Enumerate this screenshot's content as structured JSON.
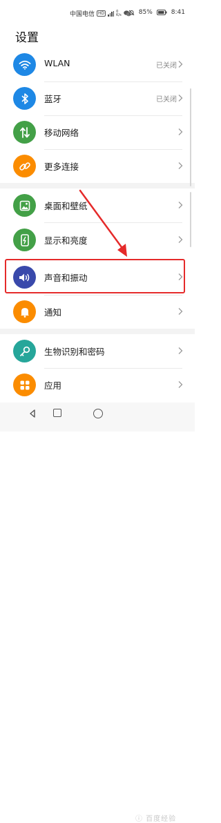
{
  "status_bar": {
    "carrier": "中国电信",
    "network_badge": "HD",
    "speed_value": "0",
    "speed_unit": "K/s",
    "battery": "85%",
    "time": "8:41"
  },
  "header": {
    "title": "设置"
  },
  "settings": [
    {
      "label": "WLAN",
      "status": "已关闭",
      "icon": "wifi-icon",
      "color": "#1e88e5"
    },
    {
      "label": "蓝牙",
      "status": "已关闭",
      "icon": "bluetooth-icon",
      "color": "#1e88e5"
    },
    {
      "label": "移动网络",
      "status": "",
      "icon": "mobile-data-icon",
      "color": "#43a047"
    },
    {
      "label": "更多连接",
      "status": "",
      "icon": "link-icon",
      "color": "#fb8c00"
    },
    {
      "label": "桌面和壁纸",
      "status": "",
      "icon": "wallpaper-icon",
      "color": "#43a047"
    },
    {
      "label": "显示和亮度",
      "status": "",
      "icon": "brightness-icon",
      "color": "#43a047"
    },
    {
      "label": "声音和振动",
      "status": "",
      "icon": "sound-icon",
      "color": "#3949ab"
    },
    {
      "label": "通知",
      "status": "",
      "icon": "notification-bell-icon",
      "color": "#fb8c00"
    },
    {
      "label": "生物识别和密码",
      "status": "",
      "icon": "key-icon",
      "color": "#26a69a"
    },
    {
      "label": "应用",
      "status": "",
      "icon": "apps-grid-icon",
      "color": "#fb8c00"
    }
  ],
  "annotation": {
    "highlight_color": "#e52a2a",
    "highlighted_item": "声音和振动"
  },
  "watermark": "ⓘ 百度经验"
}
